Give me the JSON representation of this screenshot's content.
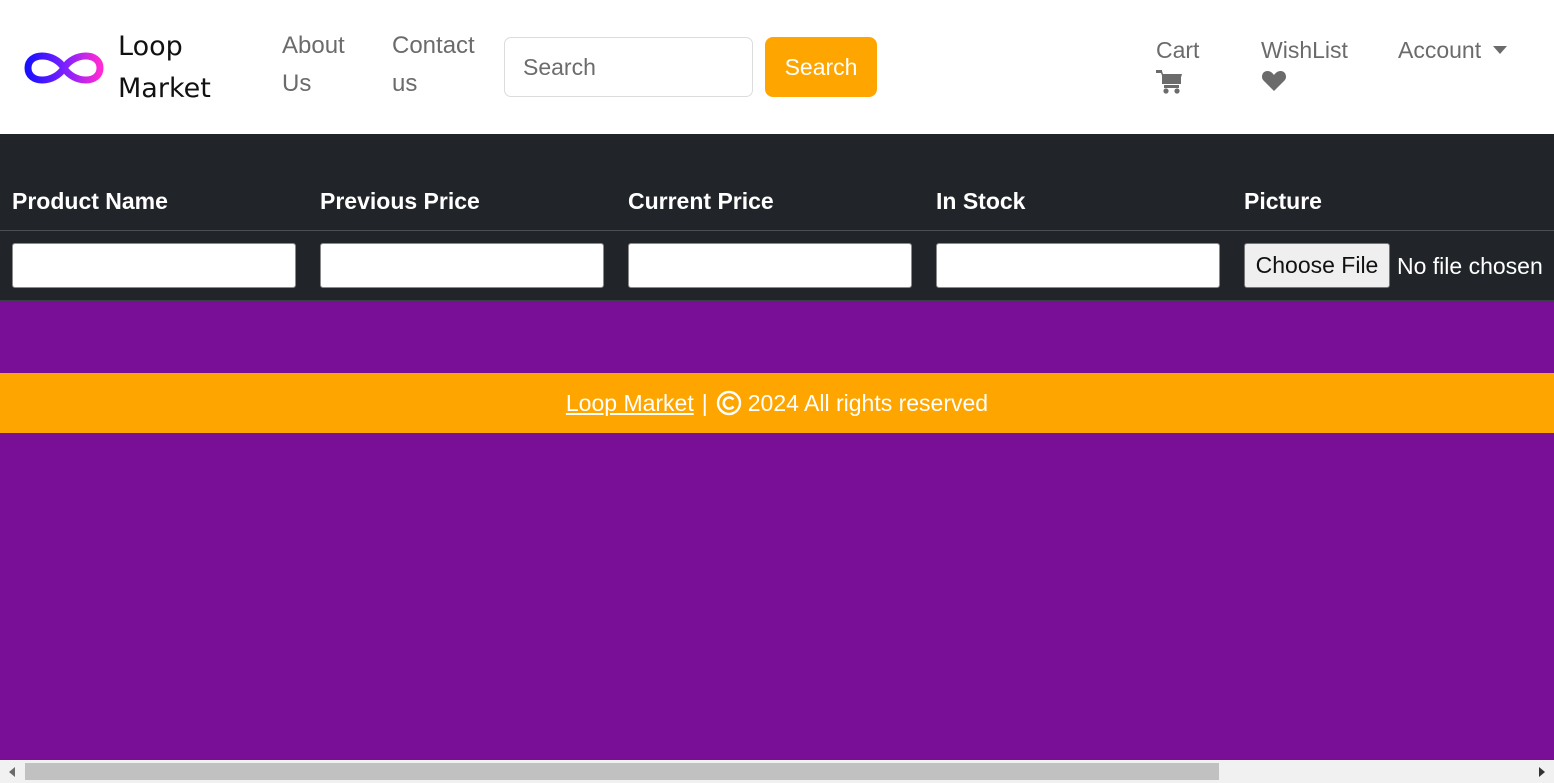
{
  "brand": {
    "name_line1": "Loop",
    "name_line2": "Market"
  },
  "nav": {
    "about": "About Us",
    "contact": "Contact us",
    "search_placeholder": "Search",
    "search_button": "Search",
    "cart": "Cart",
    "wishlist": "WishList",
    "account": "Account"
  },
  "table": {
    "headers": [
      "Product Name",
      "Previous Price",
      "Current Price",
      "In Stock",
      "Picture"
    ],
    "file_button": "Choose File",
    "file_status": "No file chosen"
  },
  "footer": {
    "link": "Loop Market",
    "separator": "|",
    "text": "2024 All rights reserved"
  },
  "colors": {
    "accent": "#ffa500",
    "page_bg": "#7a0f97",
    "table_bg": "#212529"
  }
}
